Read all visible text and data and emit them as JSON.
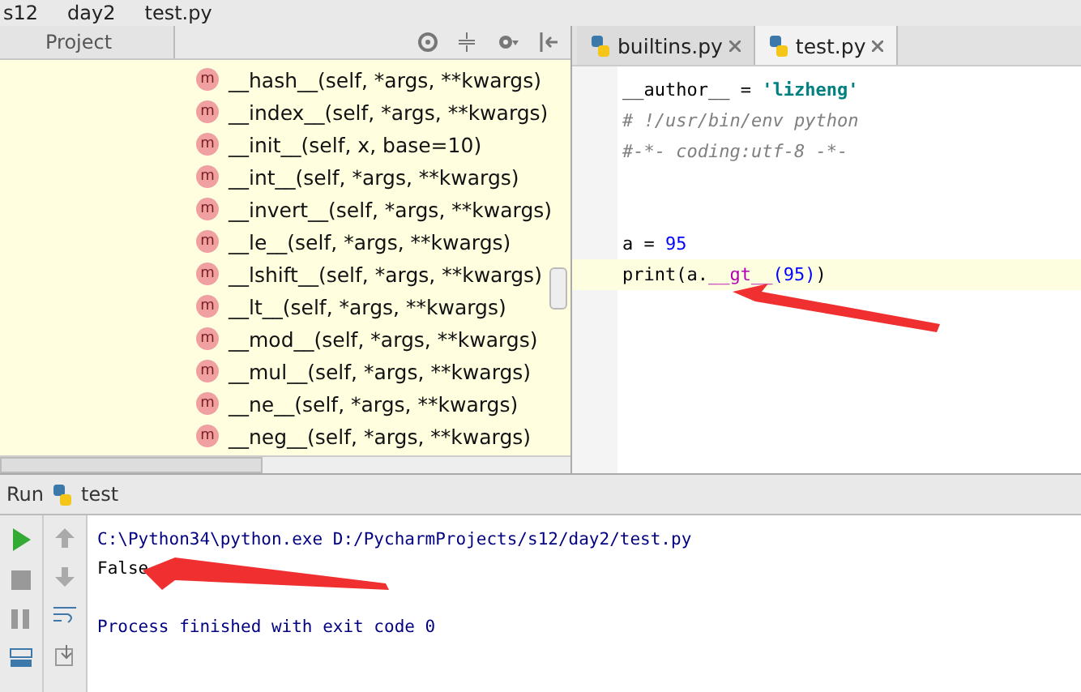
{
  "breadcrumbs": [
    "s12",
    "day2",
    "test.py"
  ],
  "project_panel": {
    "title": "Project",
    "methods": [
      {
        "badge": "m",
        "name": "__hash__(self, *args, **kwargs)"
      },
      {
        "badge": "m",
        "name": "__index__(self, *args, **kwargs)"
      },
      {
        "badge": "m",
        "name": "__init__(self, x, base=10)"
      },
      {
        "badge": "m",
        "name": "__int__(self, *args, **kwargs)"
      },
      {
        "badge": "m",
        "name": "__invert__(self, *args, **kwargs)"
      },
      {
        "badge": "m",
        "name": "__le__(self, *args, **kwargs)"
      },
      {
        "badge": "m",
        "name": "__lshift__(self, *args, **kwargs)"
      },
      {
        "badge": "m",
        "name": "__lt__(self, *args, **kwargs)"
      },
      {
        "badge": "m",
        "name": "__mod__(self, *args, **kwargs)"
      },
      {
        "badge": "m",
        "name": "__mul__(self, *args, **kwargs)"
      },
      {
        "badge": "m",
        "name": "__ne__(self, *args, **kwargs)"
      },
      {
        "badge": "m",
        "name": "__neg__(self, *args, **kwargs)"
      }
    ]
  },
  "editor_tabs": [
    {
      "label": "builtins.py",
      "selected": false
    },
    {
      "label": "test.py",
      "selected": true
    }
  ],
  "code_lines": [
    {
      "current": false,
      "tokens": [
        {
          "kind": "plain",
          "text": "__author__ = "
        },
        {
          "kind": "string",
          "text": "'lizheng'"
        }
      ]
    },
    {
      "current": false,
      "tokens": [
        {
          "kind": "comment",
          "text": "# !/usr/bin/env python"
        }
      ]
    },
    {
      "current": false,
      "tokens": [
        {
          "kind": "comment",
          "text": "#-*- coding:utf-8 -*-"
        }
      ]
    },
    {
      "current": false
    },
    {
      "current": false
    },
    {
      "current": false,
      "tokens": [
        {
          "kind": "plain",
          "text": "a = "
        },
        {
          "kind": "number",
          "text": "95"
        }
      ]
    },
    {
      "current": true,
      "tokens": [
        {
          "kind": "plain",
          "text": "print(a."
        },
        {
          "kind": "magic",
          "text": "__gt__"
        },
        {
          "kind": "number",
          "text": "(95)"
        },
        {
          "kind": "plain",
          "text": ")"
        }
      ]
    }
  ],
  "run_panel": {
    "label": "Run",
    "config": "test",
    "output": [
      {
        "kind": "system",
        "text": "C:\\Python34\\python.exe D:/PycharmProjects/s12/day2/test.py"
      },
      {
        "kind": "stdout",
        "text": "False"
      },
      {
        "kind": "blank"
      },
      {
        "kind": "system",
        "text": "Process finished with exit code 0"
      }
    ]
  }
}
